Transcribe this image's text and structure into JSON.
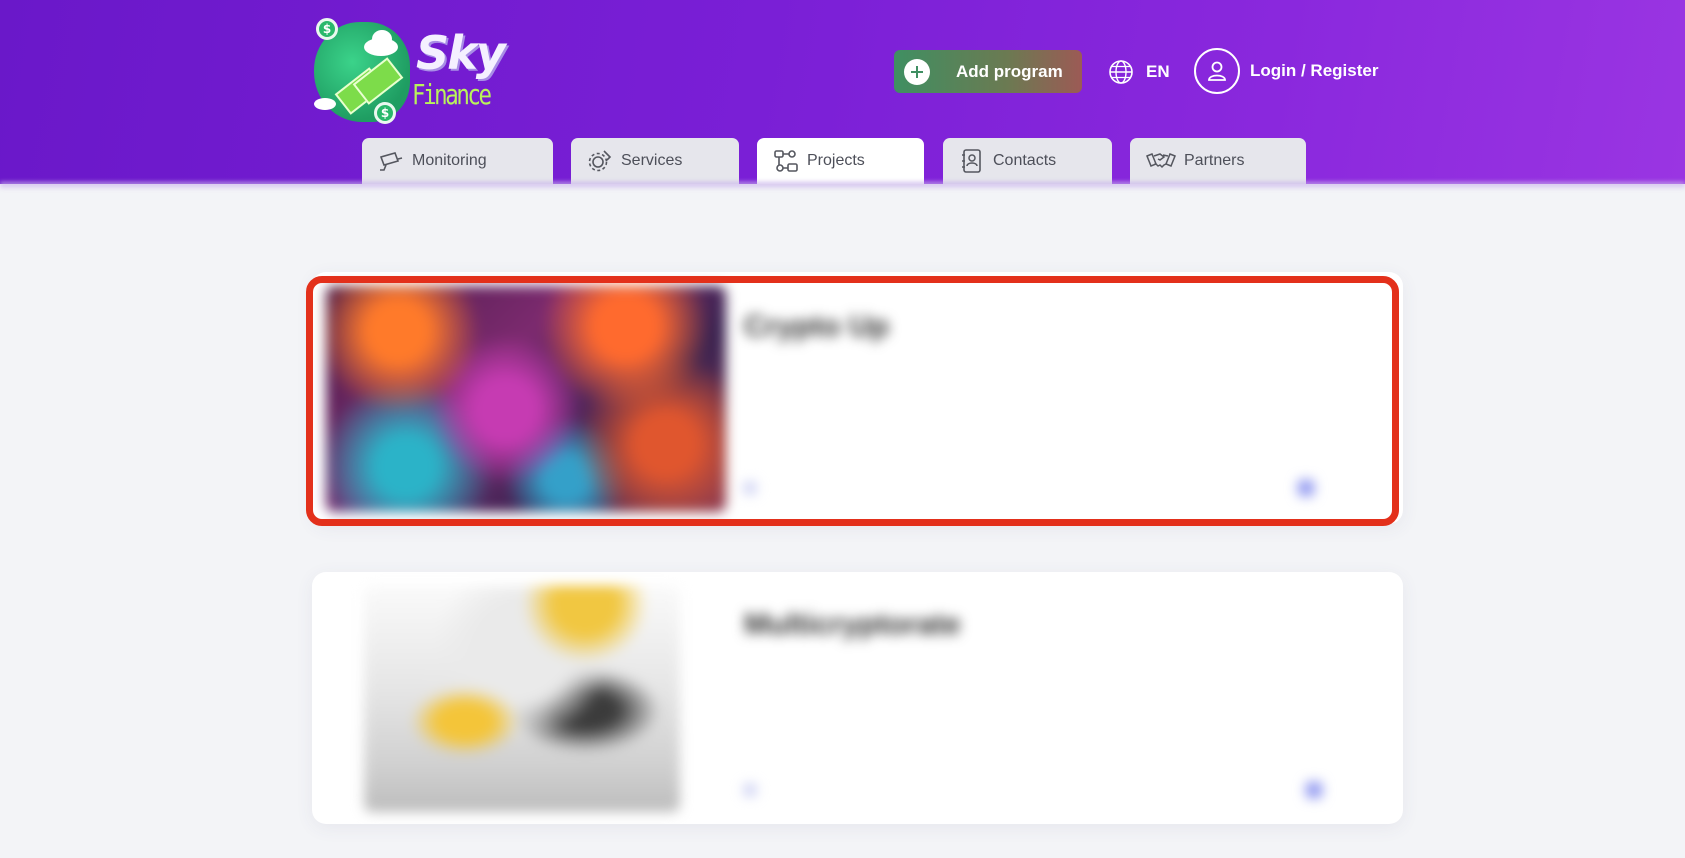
{
  "brand": {
    "name_top": "Sky",
    "name_bottom": "Finance",
    "coin_symbol": "$"
  },
  "header": {
    "add_program_label": "Add program",
    "language_label": "EN",
    "login_label": "Login / Register"
  },
  "tabs": [
    {
      "label": "Monitoring",
      "icon": "cctv-camera-icon",
      "active": false
    },
    {
      "label": "Services",
      "icon": "gear-wrench-icon",
      "active": false
    },
    {
      "label": "Projects",
      "icon": "flow-nodes-icon",
      "active": true
    },
    {
      "label": "Contacts",
      "icon": "contact-book-icon",
      "active": false
    },
    {
      "label": "Partners",
      "icon": "handshake-icon",
      "active": false
    }
  ],
  "projects": [
    {
      "title": "Crypto Up",
      "description": "",
      "meta_left": "",
      "meta_right": "",
      "highlighted": true
    },
    {
      "title": "Multicryptorate",
      "description": "",
      "meta_left": "",
      "meta_right": "",
      "highlighted": false
    }
  ],
  "colors": {
    "header_gradient_start": "#6a18c9",
    "header_gradient_end": "#9a35e2",
    "add_button_start": "#3f8f62",
    "add_button_end": "#9c5a55",
    "highlight": "#e3301b",
    "tab_bg": "#e6e6ec",
    "tab_active_bg": "#ffffff",
    "page_bg": "#f3f4f7"
  }
}
